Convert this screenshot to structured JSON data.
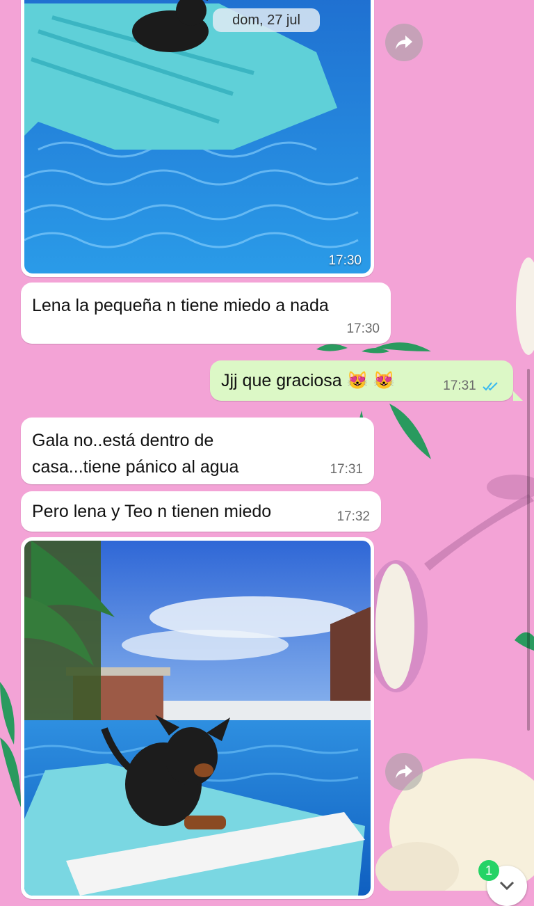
{
  "date_chip": "dom, 27 jul",
  "messages": [
    {
      "text": "Lena la pequeña n tiene miedo a nada",
      "time": "17:30"
    },
    {
      "text": "Jjj que graciosa 😻 😻",
      "time": "17:31"
    },
    {
      "text": "Gala no..está dentro de casa...tiene pánico al agua",
      "time": "17:31"
    },
    {
      "text": "Pero lena y Teo n tienen miedo",
      "time": "17:32"
    }
  ],
  "photos": [
    {
      "time": "17:30"
    }
  ],
  "floating_badge": {
    "count": "1"
  },
  "icons": [
    "forward-icon",
    "double-check-icon",
    "chevron-down-icon"
  ],
  "colors": {
    "background": "#f3a3d6",
    "incoming_bubble": "#ffffff",
    "outgoing_bubble": "#dcf8c6",
    "read_ticks": "#34b7f1",
    "badge": "#25d366"
  }
}
